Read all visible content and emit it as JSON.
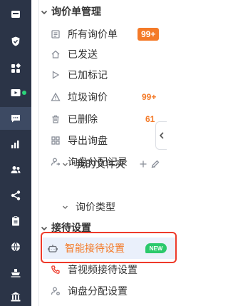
{
  "rail": {
    "items": [
      {
        "icon": "inbox-icon"
      },
      {
        "icon": "shield-icon"
      },
      {
        "icon": "apps-icon"
      },
      {
        "icon": "video-icon",
        "online": true
      },
      {
        "icon": "chat-icon",
        "active": true
      },
      {
        "icon": "bar-chart-icon"
      },
      {
        "icon": "users-icon"
      },
      {
        "icon": "share-icon"
      },
      {
        "icon": "clipboard-icon"
      },
      {
        "icon": "globe-icon"
      },
      {
        "icon": "ship-icon"
      },
      {
        "icon": "bank-icon"
      }
    ],
    "online_color": "#2bd47a"
  },
  "inquiry": {
    "title": "询价单管理",
    "items": [
      {
        "label": "所有询价单",
        "badge": "99+",
        "badge_style": "filled",
        "icon": "list-icon"
      },
      {
        "label": "已发送",
        "icon": "home-icon"
      },
      {
        "label": "已加标记",
        "icon": "flag-icon"
      },
      {
        "label": "垃圾询价",
        "badge": "99+",
        "badge_style": "text",
        "icon": "warning-icon"
      },
      {
        "label": "已删除",
        "badge": "61",
        "badge_style": "text",
        "icon": "trash-icon"
      },
      {
        "label": "导出询盘",
        "icon": "grid-icon"
      },
      {
        "label": "询盘分配记录",
        "icon": "user-transfer-icon"
      }
    ],
    "folders_label": "我的文件夹",
    "types_label": "询价类型"
  },
  "reception": {
    "title": "接待设置",
    "items": [
      {
        "label": "智能接待设置",
        "icon": "robot-icon",
        "tag": "NEW",
        "highlighted": true
      },
      {
        "label": "音视频接待设置",
        "icon": "phone-icon"
      },
      {
        "label": "询盘分配设置",
        "icon": "user-gear-icon"
      }
    ]
  },
  "colors": {
    "accent": "#f47a28",
    "highlight_border": "#ee3a2a",
    "new_tag": "#2bc96b",
    "rail_bg": "#2b3447"
  }
}
